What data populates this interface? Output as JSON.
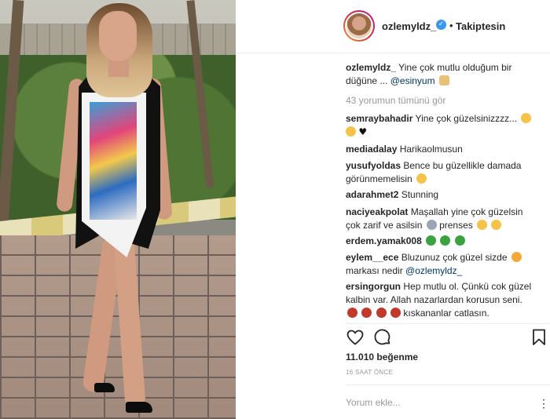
{
  "header": {
    "username": "ozlemyldz_",
    "verified_glyph": "✓",
    "separator": "•",
    "follow_status": "Takiptesin"
  },
  "caption": {
    "username": "ozlemyldz_",
    "text": "Yine çok mutlu olduğum bir düğüne ...",
    "mention": "@esinyum"
  },
  "view_all_comments": "43 yorumun tümünü gör",
  "comments": [
    {
      "username": "semraybahadir",
      "text": "Yine çok güzelsinizzzz...",
      "emojis": [
        "ok-hand-emoji",
        "thumbs-up-emoji",
        "black-heart-emoji"
      ]
    },
    {
      "username": "mediadalay",
      "text": "Harikaolmusun",
      "emojis": []
    },
    {
      "username": "yusufyoldas",
      "text": "Bence bu güzellikle damada görünmemelisin",
      "emojis": [
        "smile-emoji"
      ]
    },
    {
      "username": "adarahmet2",
      "text": "Stunning",
      "emojis": []
    },
    {
      "username": "naciyeakpolat",
      "text": "Maşallah yine çok güzelsin çok zarif ve asilsin",
      "text2": "prenses",
      "emojis": [
        "princess-emoji",
        "kiss-emoji",
        "kiss-emoji"
      ]
    },
    {
      "username": "erdem.yamak008",
      "text": "",
      "emojis": [
        "clover-emoji",
        "clover-emoji",
        "clover-emoji"
      ]
    },
    {
      "username": "eylem__ece",
      "text": "Bluzunuz çok güzel sizde",
      "text2": "markası nedir",
      "mention": "@ozlemyldz_",
      "emojis": [
        "heart-eyes-emoji"
      ]
    },
    {
      "username": "ersingorgun",
      "text": "Hep mutlu ol. Çünkü cok güzel kalbin var. Allah nazarlardan korusun seni.",
      "text2": "kıskananlar catlasın.",
      "emojis": [
        "angry-emoji",
        "angry-emoji",
        "angry-emoji",
        "angry-emoji"
      ]
    }
  ],
  "actions": {
    "like_icon": "heart-outline-icon",
    "comment_icon": "comment-bubble-icon",
    "save_icon": "bookmark-icon"
  },
  "likes": "11.010 beğenme",
  "timestamp": "16 SAAT ÖNCE",
  "comment_input": {
    "placeholder": "Yorum ekle..."
  },
  "more_glyph": "⋮",
  "colors": {
    "text": "#262626",
    "muted": "#999999",
    "verified": "#3897f0",
    "mention": "#003569",
    "divider": "#efefef"
  }
}
